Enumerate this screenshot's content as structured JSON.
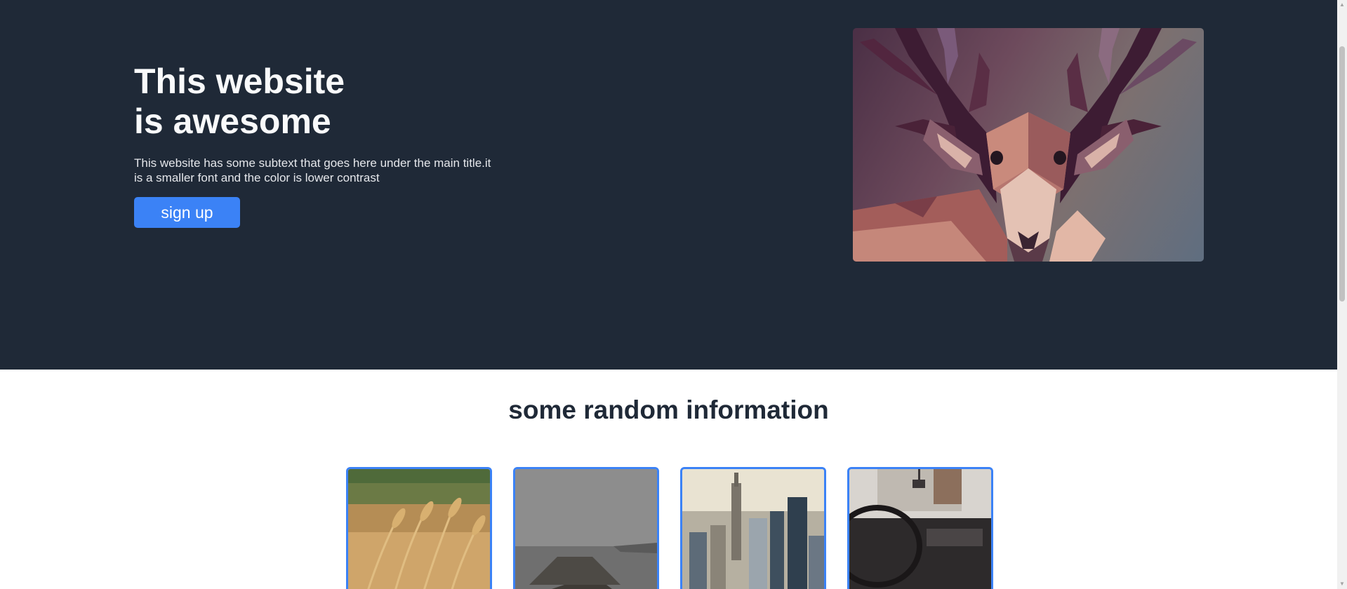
{
  "hero": {
    "title_line1": "This website",
    "title_line2": "is awesome",
    "subtext": "This website has some subtext that goes here under the main title.it is a smaller font and the color is lower contrast",
    "signup_label": "sign up",
    "image_icon": "deer-lowpoly-image"
  },
  "info": {
    "title": "some random information",
    "cards": [
      {
        "image": "wheat-field-image"
      },
      {
        "image": "foggy-pier-image"
      },
      {
        "image": "city-skyline-image"
      },
      {
        "image": "car-interior-image"
      }
    ]
  },
  "colors": {
    "hero_bg": "#1f2937",
    "accent": "#3b82f6",
    "heading_dark": "#1f2937"
  }
}
